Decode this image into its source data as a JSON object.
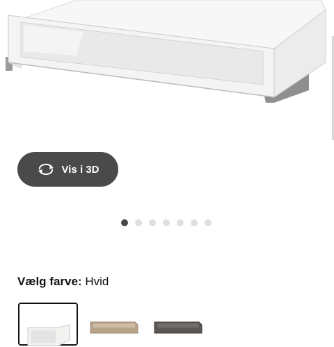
{
  "gallery": {
    "image_alt": "product-drawer-white-with-glass-front",
    "view3d_label": "Vis i 3D",
    "view3d_icon": "rotate-360-icon",
    "dots_count": 7,
    "active_dot": 1
  },
  "color_picker": {
    "label": "Vælg farve:",
    "selected_value": "Hvid",
    "swatches": [
      {
        "name": "white",
        "color": "#f2f2f0",
        "selected": true
      },
      {
        "name": "beige-oak",
        "color": "#b7a28a",
        "selected": false
      },
      {
        "name": "dark-grey",
        "color": "#5a5653",
        "selected": false
      }
    ]
  },
  "colors": {
    "button_bg": "#4a4a4a",
    "dot_active": "#484848",
    "dot_inactive": "#dfdfdf"
  }
}
